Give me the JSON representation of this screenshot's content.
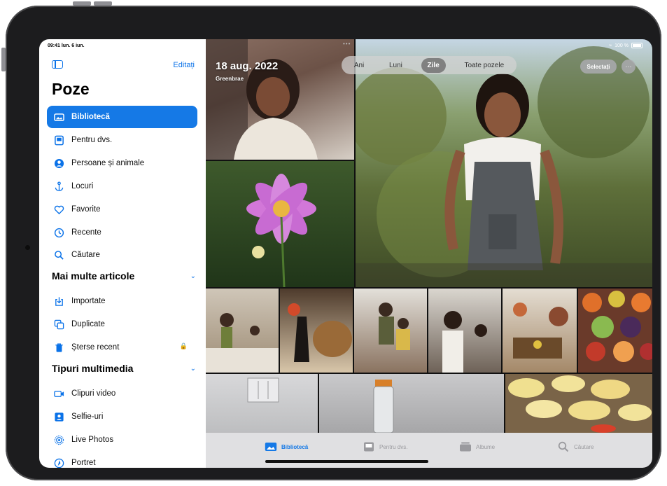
{
  "status": {
    "time": "09:41 lun. 6 iun.",
    "battery": "100 %"
  },
  "sidebar": {
    "edit_label": "Editați",
    "title": "Poze",
    "items": [
      {
        "label": "Bibliotecă",
        "icon": "photo-library-icon",
        "active": true
      },
      {
        "label": "Pentru dvs.",
        "icon": "for-you-icon"
      },
      {
        "label": "Persoane și animale",
        "icon": "person-circle-icon"
      },
      {
        "label": "Locuri",
        "icon": "anchor-icon"
      },
      {
        "label": "Favorite",
        "icon": "heart-icon"
      },
      {
        "label": "Recente",
        "icon": "clock-icon"
      },
      {
        "label": "Căutare",
        "icon": "search-icon"
      }
    ],
    "section_more": {
      "title": "Mai multe articole",
      "items": [
        {
          "label": "Importate",
          "icon": "import-icon"
        },
        {
          "label": "Duplicate",
          "icon": "duplicate-icon"
        },
        {
          "label": "Șterse recent",
          "icon": "trash-icon",
          "locked": true
        }
      ]
    },
    "section_media": {
      "title": "Tipuri multimedia",
      "items": [
        {
          "label": "Clipuri video",
          "icon": "video-icon"
        },
        {
          "label": "Selfie-uri",
          "icon": "selfie-icon"
        },
        {
          "label": "Live Photos",
          "icon": "live-photo-icon"
        },
        {
          "label": "Portret",
          "icon": "portrait-icon"
        }
      ]
    }
  },
  "main": {
    "date_title": "18 aug. 2022",
    "place": "Greenbrae",
    "segments": [
      {
        "label": "Ani"
      },
      {
        "label": "Luni"
      },
      {
        "label": "Zile",
        "selected": true
      },
      {
        "label": "Toate pozele"
      }
    ],
    "select_label": "Selectați",
    "more_label": "···"
  },
  "tabbar": {
    "tabs": [
      {
        "label": "Bibliotecă",
        "icon": "photo-library-icon",
        "active": true
      },
      {
        "label": "Pentru dvs.",
        "icon": "for-you-icon"
      },
      {
        "label": "Albume",
        "icon": "albums-icon"
      },
      {
        "label": "Căutare",
        "icon": "search-icon"
      }
    ]
  },
  "colors": {
    "accent": "#1579e6",
    "sidebar_bg": "#ffffff",
    "bezel": "#1c1c1e"
  }
}
